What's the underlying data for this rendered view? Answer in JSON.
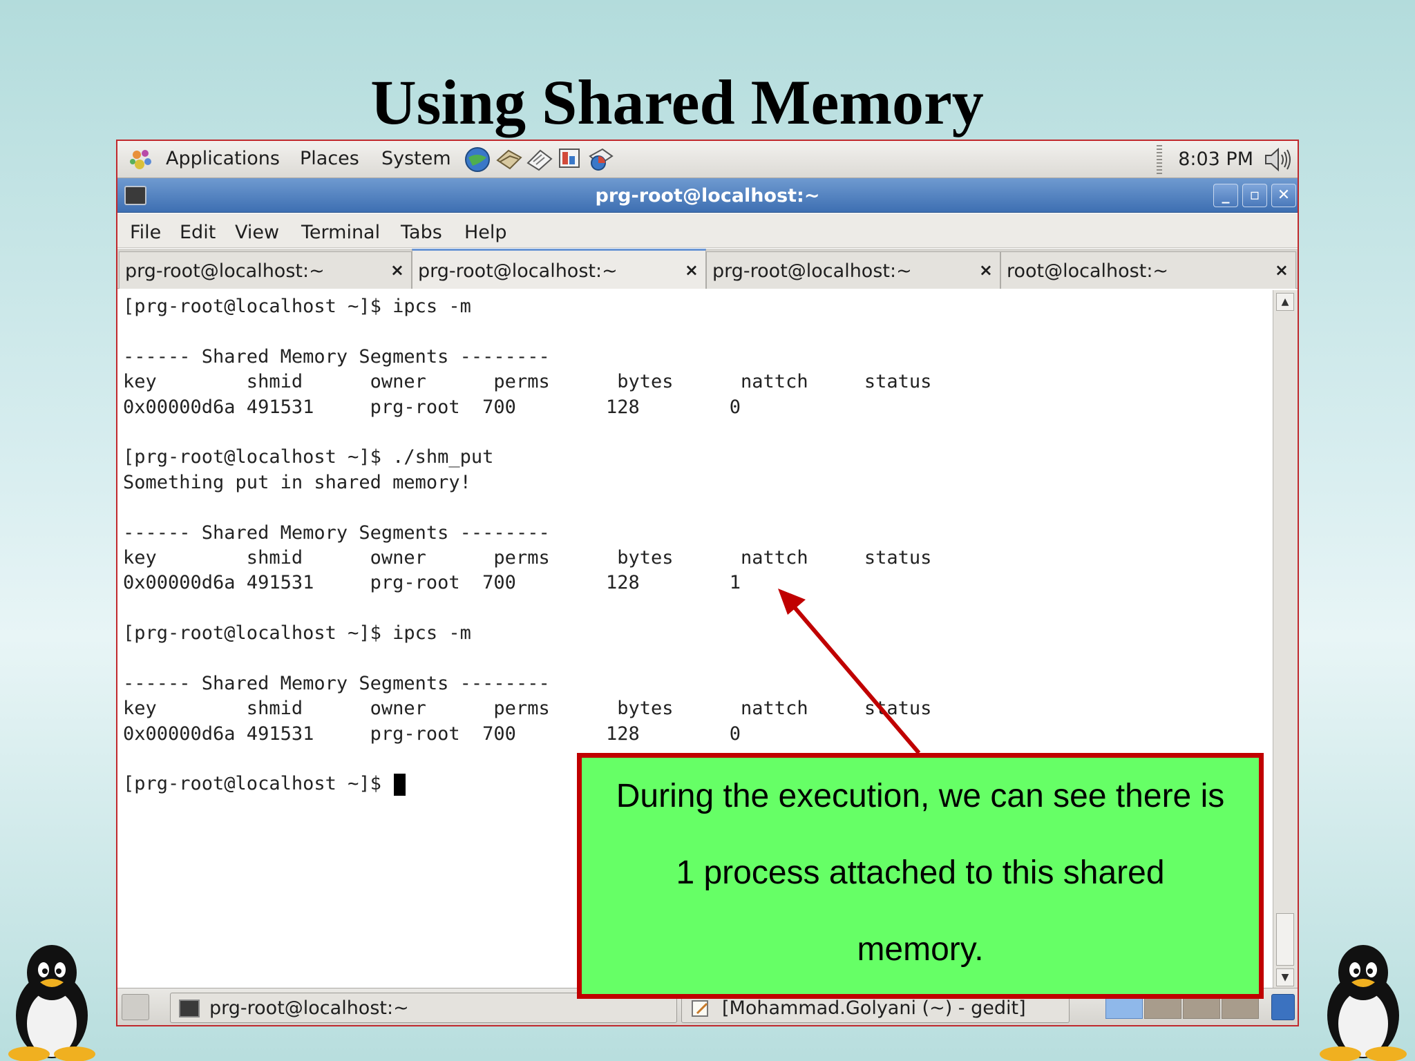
{
  "slide": {
    "title": "Using Shared Memory"
  },
  "top_panel": {
    "menus": [
      "Applications",
      "Places",
      "System"
    ],
    "clock": "8:03 PM"
  },
  "window": {
    "title": "prg-root@localhost:~",
    "menubar": [
      "File",
      "Edit",
      "View",
      "Terminal",
      "Tabs",
      "Help"
    ],
    "tabs": [
      {
        "label": "prg-root@localhost:~",
        "close": "×"
      },
      {
        "label": "prg-root@localhost:~",
        "close": "×"
      },
      {
        "label": "prg-root@localhost:~",
        "close": "×"
      },
      {
        "label": "root@localhost:~",
        "close": "×"
      }
    ],
    "active_tab": 1
  },
  "terminal": {
    "lines": [
      "[prg-root@localhost ~]$ ipcs -m",
      "",
      "------ Shared Memory Segments --------",
      "key        shmid      owner      perms      bytes      nattch     status",
      "0x00000d6a 491531     prg-root  700        128        0",
      "",
      "[prg-root@localhost ~]$ ./shm_put",
      "Something put in shared memory!",
      "",
      "------ Shared Memory Segments --------",
      "key        shmid      owner      perms      bytes      nattch     status",
      "0x00000d6a 491531     prg-root  700        128        1",
      "",
      "[prg-root@localhost ~]$ ipcs -m",
      "",
      "------ Shared Memory Segments --------",
      "key        shmid      owner      perms      bytes      nattch     status",
      "0x00000d6a 491531     prg-root  700        128        0",
      "",
      "[prg-root@localhost ~]$ "
    ]
  },
  "bottom_panel": {
    "tasks": [
      "prg-root@localhost:~",
      "[Mohammad.Golyani (~) - gedit]"
    ]
  },
  "callout": {
    "lines": [
      "During the execution, we can see there is",
      "1 process attached to this shared",
      "memory."
    ]
  },
  "colors": {
    "callout_bg": "#66ff66",
    "callout_border": "#c00000",
    "arrow": "#c00000"
  }
}
